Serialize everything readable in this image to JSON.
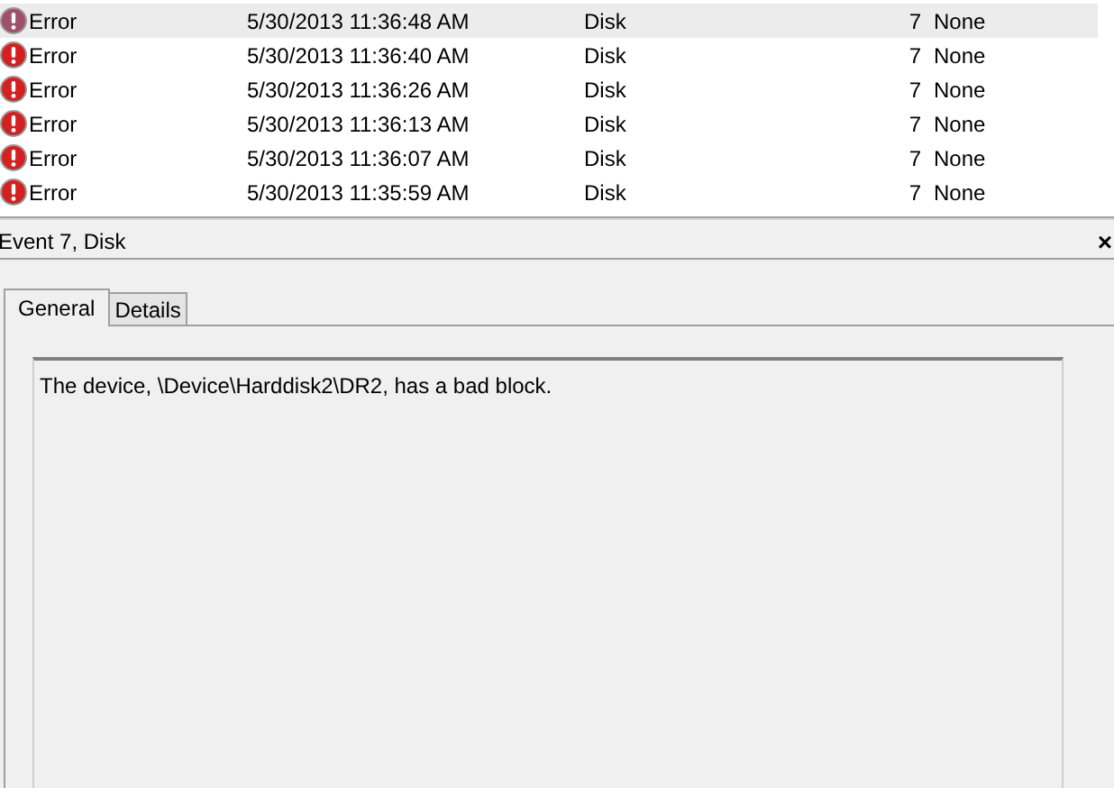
{
  "events": [
    {
      "level": "Error",
      "date": "5/30/2013 11:36:48 AM",
      "source": "Disk",
      "event_id": "7",
      "task": "None",
      "selected": true
    },
    {
      "level": "Error",
      "date": "5/30/2013 11:36:40 AM",
      "source": "Disk",
      "event_id": "7",
      "task": "None",
      "selected": false
    },
    {
      "level": "Error",
      "date": "5/30/2013 11:36:26 AM",
      "source": "Disk",
      "event_id": "7",
      "task": "None",
      "selected": false
    },
    {
      "level": "Error",
      "date": "5/30/2013 11:36:13 AM",
      "source": "Disk",
      "event_id": "7",
      "task": "None",
      "selected": false
    },
    {
      "level": "Error",
      "date": "5/30/2013 11:36:07 AM",
      "source": "Disk",
      "event_id": "7",
      "task": "None",
      "selected": false
    },
    {
      "level": "Error",
      "date": "5/30/2013 11:35:59 AM",
      "source": "Disk",
      "event_id": "7",
      "task": "None",
      "selected": false
    }
  ],
  "detail": {
    "title": "Event 7, Disk",
    "close": "×",
    "tabs": [
      {
        "label": "General",
        "selected": true
      },
      {
        "label": "Details",
        "selected": false
      }
    ],
    "message": "The device, \\Device\\Harddisk2\\DR2, has a bad block."
  }
}
